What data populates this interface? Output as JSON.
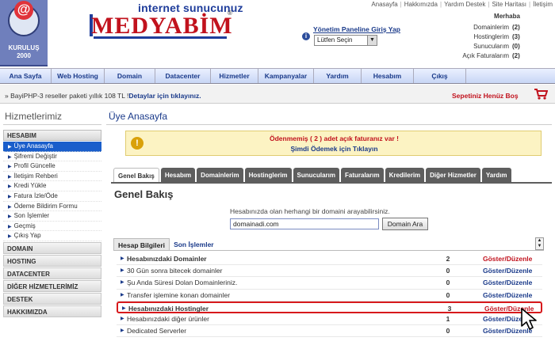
{
  "header": {
    "mascot_text": "@",
    "founded_label": "KURULUŞ",
    "founded_year": "2000",
    "brand_tagline": "internet sunucunuz",
    "brand_name": "MEDYABİM",
    "brand_reg": "®",
    "panel_label": "Yönetim Paneline Giriş Yap",
    "panel_select_value": "Lütfen Seçin",
    "top_links": [
      "Anasayfa",
      "Hakkımızda",
      "Yardım Destek",
      "Site Haritası",
      "İletişim"
    ],
    "account": {
      "title": "Merhaba",
      "rows": [
        {
          "label": "Domainlerim",
          "value": "(2)"
        },
        {
          "label": "Hostinglerim",
          "value": "(3)"
        },
        {
          "label": "Sunucularım",
          "value": "(0)"
        },
        {
          "label": "Açık Faturalarım",
          "value": "(2)"
        }
      ]
    }
  },
  "nav": [
    "Ana Sayfa",
    "Web Hosting",
    "Domain",
    "Datacenter",
    "Hizmetler",
    "Kampanyalar",
    "Yardım",
    "Hesabım",
    "Çıkış"
  ],
  "promo": {
    "text": "» BayiPHP-3 reseller paketi yıllık 108 TL !",
    "link": "Detaylar için tıklayınız."
  },
  "cart": "Sepetiniz Henüz Boş",
  "sidebar": {
    "title": "Hizmetlerimiz",
    "section": "HESABIM",
    "items": [
      "Üye Anasayfa",
      "Şifremi Değiştir",
      "Profil Güncelle",
      "İletişim Rehberi",
      "Kredi Yükle",
      "Fatura İzle/Öde",
      "Ödeme Bildirim Formu",
      "Son İşlemler",
      "Geçmiş",
      "Çıkış Yap"
    ],
    "categories": [
      "DOMAIN",
      "HOSTING",
      "DATACENTER",
      "DİĞER HİZMETLERİMİZ",
      "DESTEK",
      "HAKKIMIZDA"
    ]
  },
  "content": {
    "title": "Üye Anasayfa",
    "alert_line1": "Ödenmemiş ( 2 ) adet açık faturanız var !",
    "alert_line2": "Şimdi Ödemek için Tıklayın",
    "tabs": [
      "Genel Bakış",
      "Hesabım",
      "Domainlerim",
      "Hostinglerim",
      "Sunucularım",
      "Faturalarım",
      "Kredilerim",
      "Diğer Hizmetler",
      "Yardım"
    ],
    "section_title": "Genel Bakış",
    "search_label": "Hesabınızda olan herhangi bir domaini arayabilirsiniz.",
    "search_value": "domainadi.com",
    "search_button": "Domain Ara",
    "inner_tabs": [
      "Hesap Bilgileri",
      "Son İşlemler"
    ],
    "rows": [
      {
        "label": "Hesabınızdaki Domainler",
        "count": "2",
        "action": "Göster/Düzenle",
        "bold": true,
        "red": true
      },
      {
        "label": "30 Gün sonra bitecek domainler",
        "count": "0",
        "action": "Göster/Düzenle",
        "bold": false,
        "red": false
      },
      {
        "label": "Şu Anda Süresi Dolan Domainleriniz.",
        "count": "0",
        "action": "Göster/Düzenle",
        "bold": false,
        "red": false
      },
      {
        "label": "Transfer işlemine konan domainler",
        "count": "0",
        "action": "Göster/Düzenle",
        "bold": false,
        "red": false
      },
      {
        "label": "Hesabınızdaki Hostingler",
        "count": "3",
        "action": "Göster/Düzenle",
        "bold": true,
        "red": true
      },
      {
        "label": "Hesabınızdaki diğer ürünler",
        "count": "1",
        "action": "Göster/Düzenle",
        "bold": false,
        "red": false
      },
      {
        "label": "Dedicated Serverler",
        "count": "0",
        "action": "Göster/Düzenle",
        "bold": false,
        "red": false
      }
    ]
  }
}
